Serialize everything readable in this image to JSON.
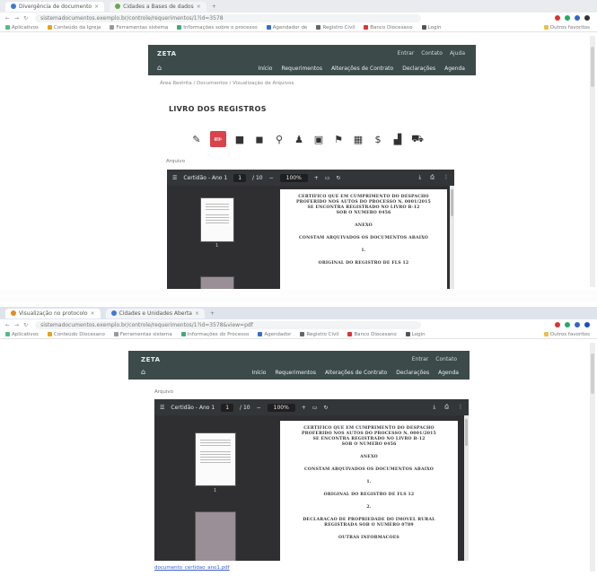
{
  "shot1": {
    "tabs": [
      {
        "label": "Divergência de documento",
        "active": true
      },
      {
        "label": "Cidades a Bases de dados",
        "active": false
      }
    ],
    "url": "sistemadocumentos.exemplo.br/controle/requerimentos/1?id=3578",
    "bookmarks": [
      "Aplicativos",
      "Conteúdo da Igreja",
      "Ferramentas sistema",
      "Informações sobre o processo",
      "Agendador de",
      "Registro Civil",
      "Banco Diocesano",
      "Login",
      "Outros favoritos"
    ],
    "site": {
      "brand": "ZETA",
      "toplinks": [
        "Entrar",
        "Contato",
        "Ajuda"
      ],
      "menu": [
        "Início",
        "Requerimentos",
        "Alterações de Contrato",
        "Declarações",
        "Agenda"
      ]
    },
    "breadcrumb": "Área Restrita / Documentos / Visualização de Arquivos",
    "page_title": "LIVRO DOS REGISTROS",
    "field_label": "Arquivo",
    "viewer": {
      "title": "Certidão - Ano 1",
      "page_input": "1",
      "page_total": "/ 10",
      "zoom": "100%",
      "thumb_page": "1",
      "paragraphs": [
        [
          "CERTIFICO QUE EM CUMPRIMENTO DO DESPACHO",
          "PROFERIDO NOS AUTOS DO PROCESSO N. 0001/2015",
          "SE ENCONTRA REGISTRADO NO LIVRO B-12",
          "SOB O NUMERO 0456"
        ],
        [
          "ANEXO"
        ],
        [
          "CONSTAM ARQUIVADOS OS DOCUMENTOS ABAIXO"
        ],
        [
          "1."
        ],
        [
          "ORIGINAL DO REGISTRO DE FLS 12"
        ]
      ]
    }
  },
  "shot2": {
    "tabs": [
      {
        "label": "Visualização no protocolo",
        "active": true
      },
      {
        "label": "Cidades e Unidades Aberta",
        "active": false
      }
    ],
    "url": "sistemadocumentos.exemplo.br/controle/requerimentos/1?id=3578&view=pdf",
    "bookmarks": [
      "Aplicativos",
      "Conteúdo Diocesano",
      "Ferramentas sistema",
      "Informações do Processo",
      "Agendador",
      "Registro Civil",
      "Banco Diocesano",
      "Login",
      "Outros favoritos"
    ],
    "site": {
      "brand": "ZETA",
      "toplinks": [
        "Entrar",
        "Contato"
      ],
      "menu": [
        "Início",
        "Requerimentos",
        "Alterações de Contrato",
        "Declarações",
        "Agenda"
      ]
    },
    "field_label": "Arquivo",
    "viewer": {
      "title": "Certidão - Ano 1",
      "page_input": "1",
      "page_total": "/ 10",
      "zoom": "100%",
      "thumb_page": "1",
      "paragraphs": [
        [
          "CERTIFICO QUE EM CUMPRIMENTO DO DESPACHO",
          "PROFERIDO NOS AUTOS DO PROCESSO N. 0001/2015",
          "SE ENCONTRA REGISTRADO NO LIVRO B-12",
          "SOB O NUMERO 0456"
        ],
        [
          "ANEXO"
        ],
        [
          "CONSTAM ARQUIVADOS OS DOCUMENTOS ABAIXO"
        ],
        [
          "1."
        ],
        [
          "ORIGINAL DO REGISTRO DE FLS 12"
        ],
        [
          "2."
        ],
        [
          "DECLARACAO DE PROPRIEDADE DO IMOVEL RURAL",
          "REGISTRADA SOB O NUMERO 0789"
        ],
        [
          "OUTRAS INFORMACOES"
        ]
      ]
    },
    "footer_link": "documento_certidao_ano1.pdf"
  },
  "colors": {
    "site_header": "#3d4a4a",
    "active_tool": "#d9434a",
    "viewer_bg": "#2f2f31"
  }
}
